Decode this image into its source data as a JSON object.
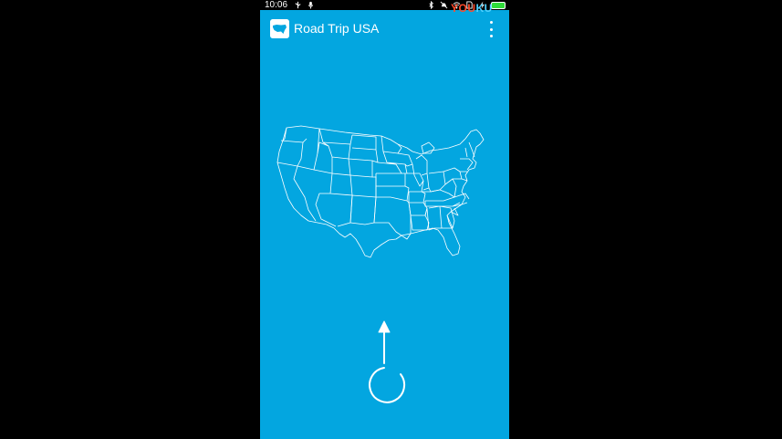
{
  "status_bar": {
    "time": "10:06",
    "left_icons": [
      "usb-icon",
      "mic-icon"
    ],
    "right_icons": [
      "bluetooth-icon",
      "mute-icon",
      "wifi-icon",
      "sim-icon",
      "charging-icon",
      "battery-icon"
    ]
  },
  "app_bar": {
    "title": "Road Trip USA",
    "icon": "us-map-app-icon",
    "menu_icon": "overflow-menu-icon"
  },
  "watermark": {
    "part1": "YOU",
    "part2": "KU"
  },
  "main": {
    "map": "us-states-map",
    "hint_icon": "swipe-up-arrow-icon"
  },
  "colors": {
    "screen_background": "#03a6e0",
    "outer_background": "#000000",
    "map_stroke": "#ffffff",
    "battery_fill": "#2fdc3a"
  }
}
